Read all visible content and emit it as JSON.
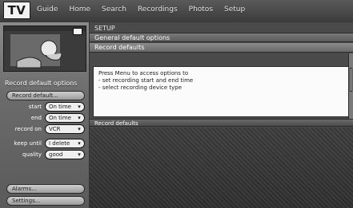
{
  "header": {
    "logo": "TV",
    "nav": [
      "Guide",
      "Home",
      "Search",
      "Recordings",
      "Photos",
      "Setup"
    ]
  },
  "left_panel": {
    "menu_header": "Record default options",
    "menu_items": [
      "Record default...",
      "Alarms...",
      "Settings..."
    ],
    "fields": [
      {
        "label": "start",
        "value": "On time"
      },
      {
        "label": "end",
        "value": "On time"
      },
      {
        "label": "record on",
        "value": "VCR"
      },
      {
        "label": "keep until",
        "value": "I delete"
      },
      {
        "label": "quality",
        "value": "good"
      }
    ]
  },
  "main": {
    "breadcrumb": "SETUP",
    "title": "General default options",
    "section": "Record defaults",
    "info_lines": [
      "Press Menu to access options to",
      "- set recording start and end time",
      "- select recording device type"
    ],
    "lower_section": "Record defaults"
  }
}
